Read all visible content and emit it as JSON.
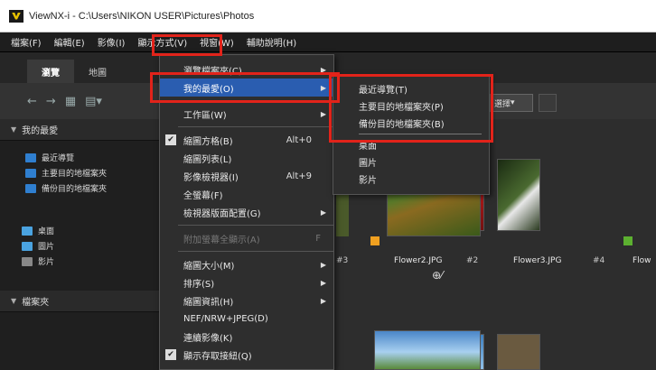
{
  "window": {
    "title": "ViewNX-i - C:\\Users\\NIKON USER\\Pictures\\Photos"
  },
  "menubar": {
    "items": [
      "檔案(F)",
      "編輯(E)",
      "影像(I)",
      "顯示方式(V)",
      "視窗(W)",
      "輔助說明(H)"
    ]
  },
  "tabs": [
    "瀏覽",
    "地圖"
  ],
  "left_panel": {
    "my_items_header": "我的最愛",
    "my_items": [
      "最近導覽",
      "主要目的地檔案夾",
      "備份目的地檔案夾"
    ],
    "lib_items": [
      "桌面",
      "圖片",
      "影片"
    ],
    "folders_header": "檔案夾"
  },
  "dropdown": {
    "items": [
      {
        "label": "瀏覽檔案夾(C)",
        "submenu": true
      },
      {
        "label": "我的最愛(O)",
        "submenu": true,
        "highlighted": true
      },
      {
        "sep": true
      },
      {
        "label": "工作區(W)",
        "submenu": true
      },
      {
        "sep": true
      },
      {
        "label": "縮圖方格(B)",
        "shortcut": "Alt+0",
        "checked": true
      },
      {
        "label": "縮圖列表(L)"
      },
      {
        "label": "影像檢視器(I)",
        "shortcut": "Alt+9"
      },
      {
        "label": "全螢幕(F)"
      },
      {
        "label": "檢視器版面配置(G)",
        "submenu": true
      },
      {
        "sep": true
      },
      {
        "label": "附加螢幕全顯示(A)",
        "shortcut": "F",
        "disabled": true
      },
      {
        "sep": true
      },
      {
        "label": "縮圖大小(M)",
        "submenu": true
      },
      {
        "label": "排序(S)",
        "submenu": true
      },
      {
        "label": "縮圖資訊(H)",
        "submenu": true
      },
      {
        "label": "NEF/NRW+JPEG(D)"
      },
      {
        "label": "連續影像(K)"
      },
      {
        "label": "顯示存取接紐(Q)",
        "checked": true
      }
    ]
  },
  "submenu": {
    "top_items": [
      "最近導覽(T)",
      "主要目的地檔案夾(P)",
      "備份目的地檔案夾(B)"
    ],
    "bottom_items": [
      "桌面",
      "圖片",
      "影片"
    ]
  },
  "filter_label": "選擇",
  "thumbs": [
    {
      "label": "Flower2.JPG",
      "num": "#2"
    },
    {
      "label": "Flower3.JPG",
      "num": "#4"
    },
    {
      "label": "Flow",
      "num": ""
    }
  ],
  "thumb_prev_num": "#3",
  "shortcut_label": "Alt+0",
  "colors": {
    "highlight": "#2a5db0",
    "annotation_red": "#e2231a"
  }
}
